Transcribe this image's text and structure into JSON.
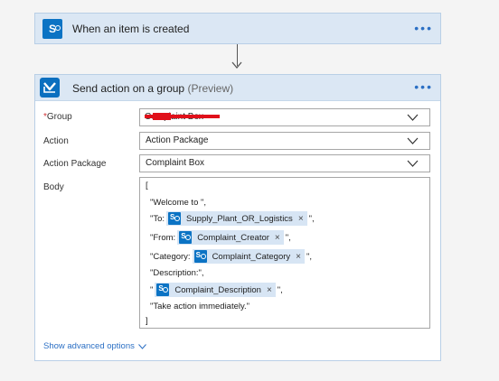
{
  "trigger": {
    "title": "When an item is created",
    "more_label": "•••"
  },
  "action": {
    "title": "Send action on a group",
    "preview": "(Preview)",
    "more_label": "•••",
    "fields": {
      "group": {
        "required_mark": "*",
        "label": "Group",
        "value": "Complaint Box"
      },
      "action": {
        "label": "Action",
        "value": "Action Package"
      },
      "action_package": {
        "label": "Action Package",
        "value": "Complaint Box"
      },
      "body": {
        "label": "Body",
        "open_bracket": "[",
        "welcome": "\"Welcome to \",",
        "to_prefix": "\"To:",
        "to_token": "Supply_Plant_OR_Logistics",
        "to_suffix": "\",",
        "from_prefix": "\"From:",
        "from_token": "Complaint_Creator",
        "from_suffix": "\",",
        "category_prefix": "\"Category:",
        "category_token": "Complaint_Category",
        "category_suffix": "\",",
        "description_label": "\"Description:\",",
        "desc_prefix": "\"",
        "desc_token": "Complaint_Description",
        "desc_suffix": "\",",
        "take_action": "\"Take action immediately.\"",
        "close_bracket": "]",
        "token_remove": "×"
      }
    },
    "advanced_options": "Show advanced options"
  },
  "colors": {
    "header_bg": "#dbe7f4",
    "accent": "#2b6fc4",
    "sharepoint_blue": "#0b73c4",
    "token_bg": "#d7e5f4",
    "required": "#d13438"
  }
}
